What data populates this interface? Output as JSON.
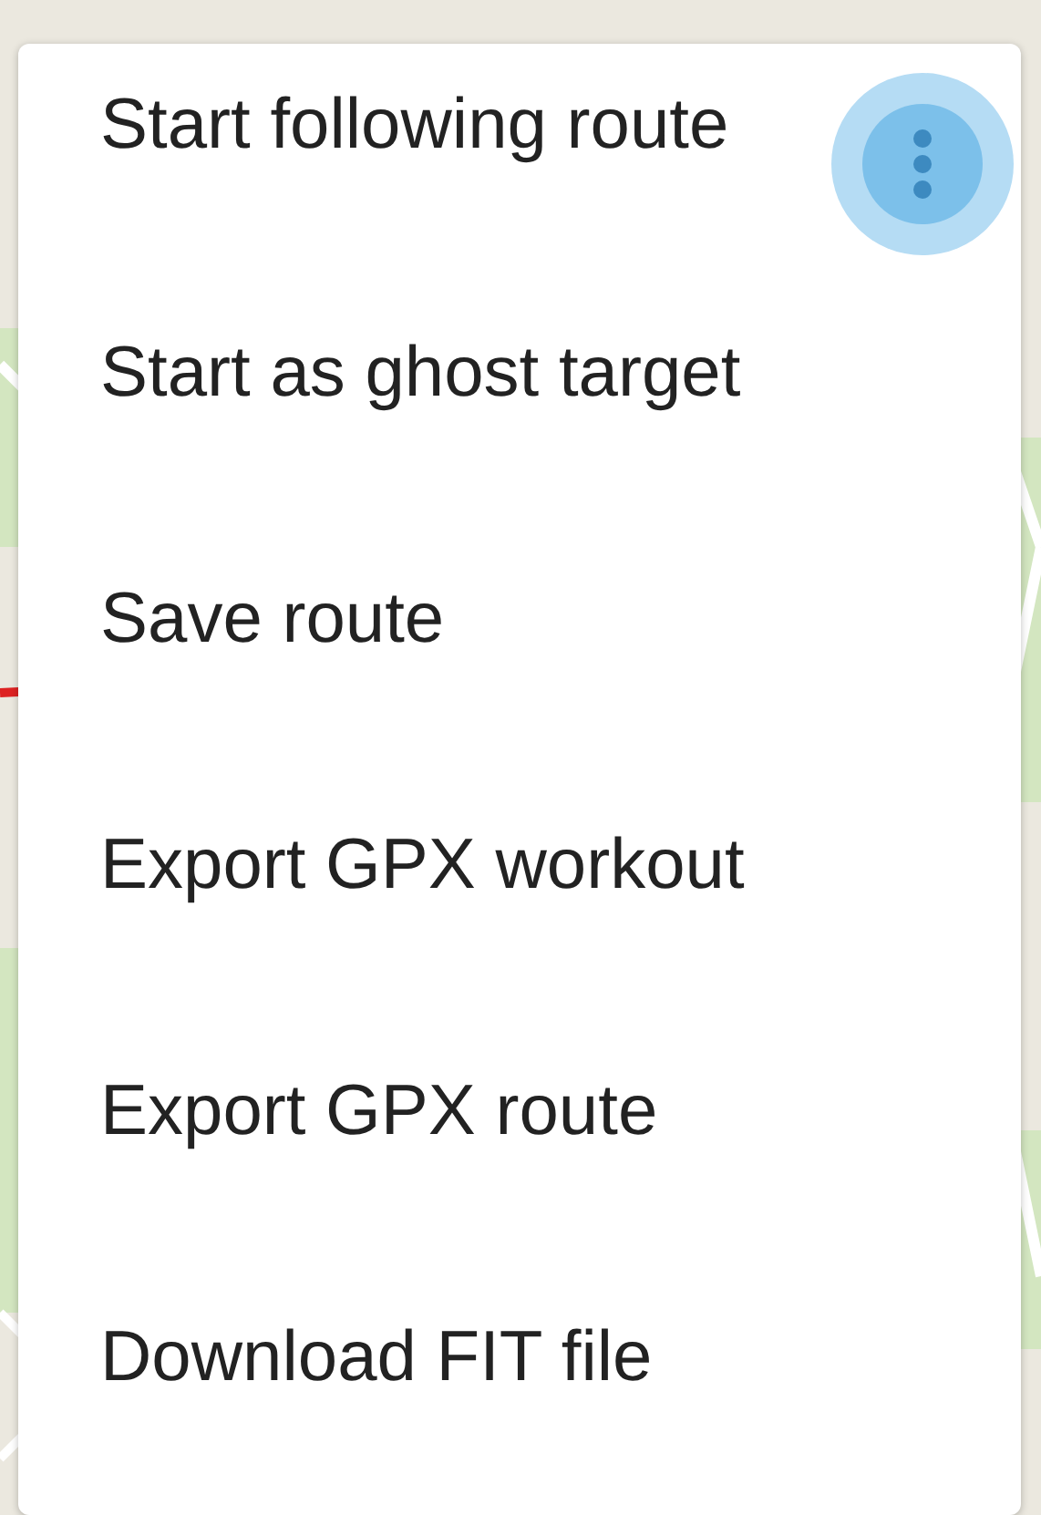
{
  "menu": {
    "items": [
      {
        "label": "Start following route"
      },
      {
        "label": "Start as ghost target"
      },
      {
        "label": "Save route"
      },
      {
        "label": "Export GPX workout"
      },
      {
        "label": "Export GPX route"
      },
      {
        "label": "Download FIT file"
      }
    ]
  },
  "more_button": {
    "pressed": true
  }
}
